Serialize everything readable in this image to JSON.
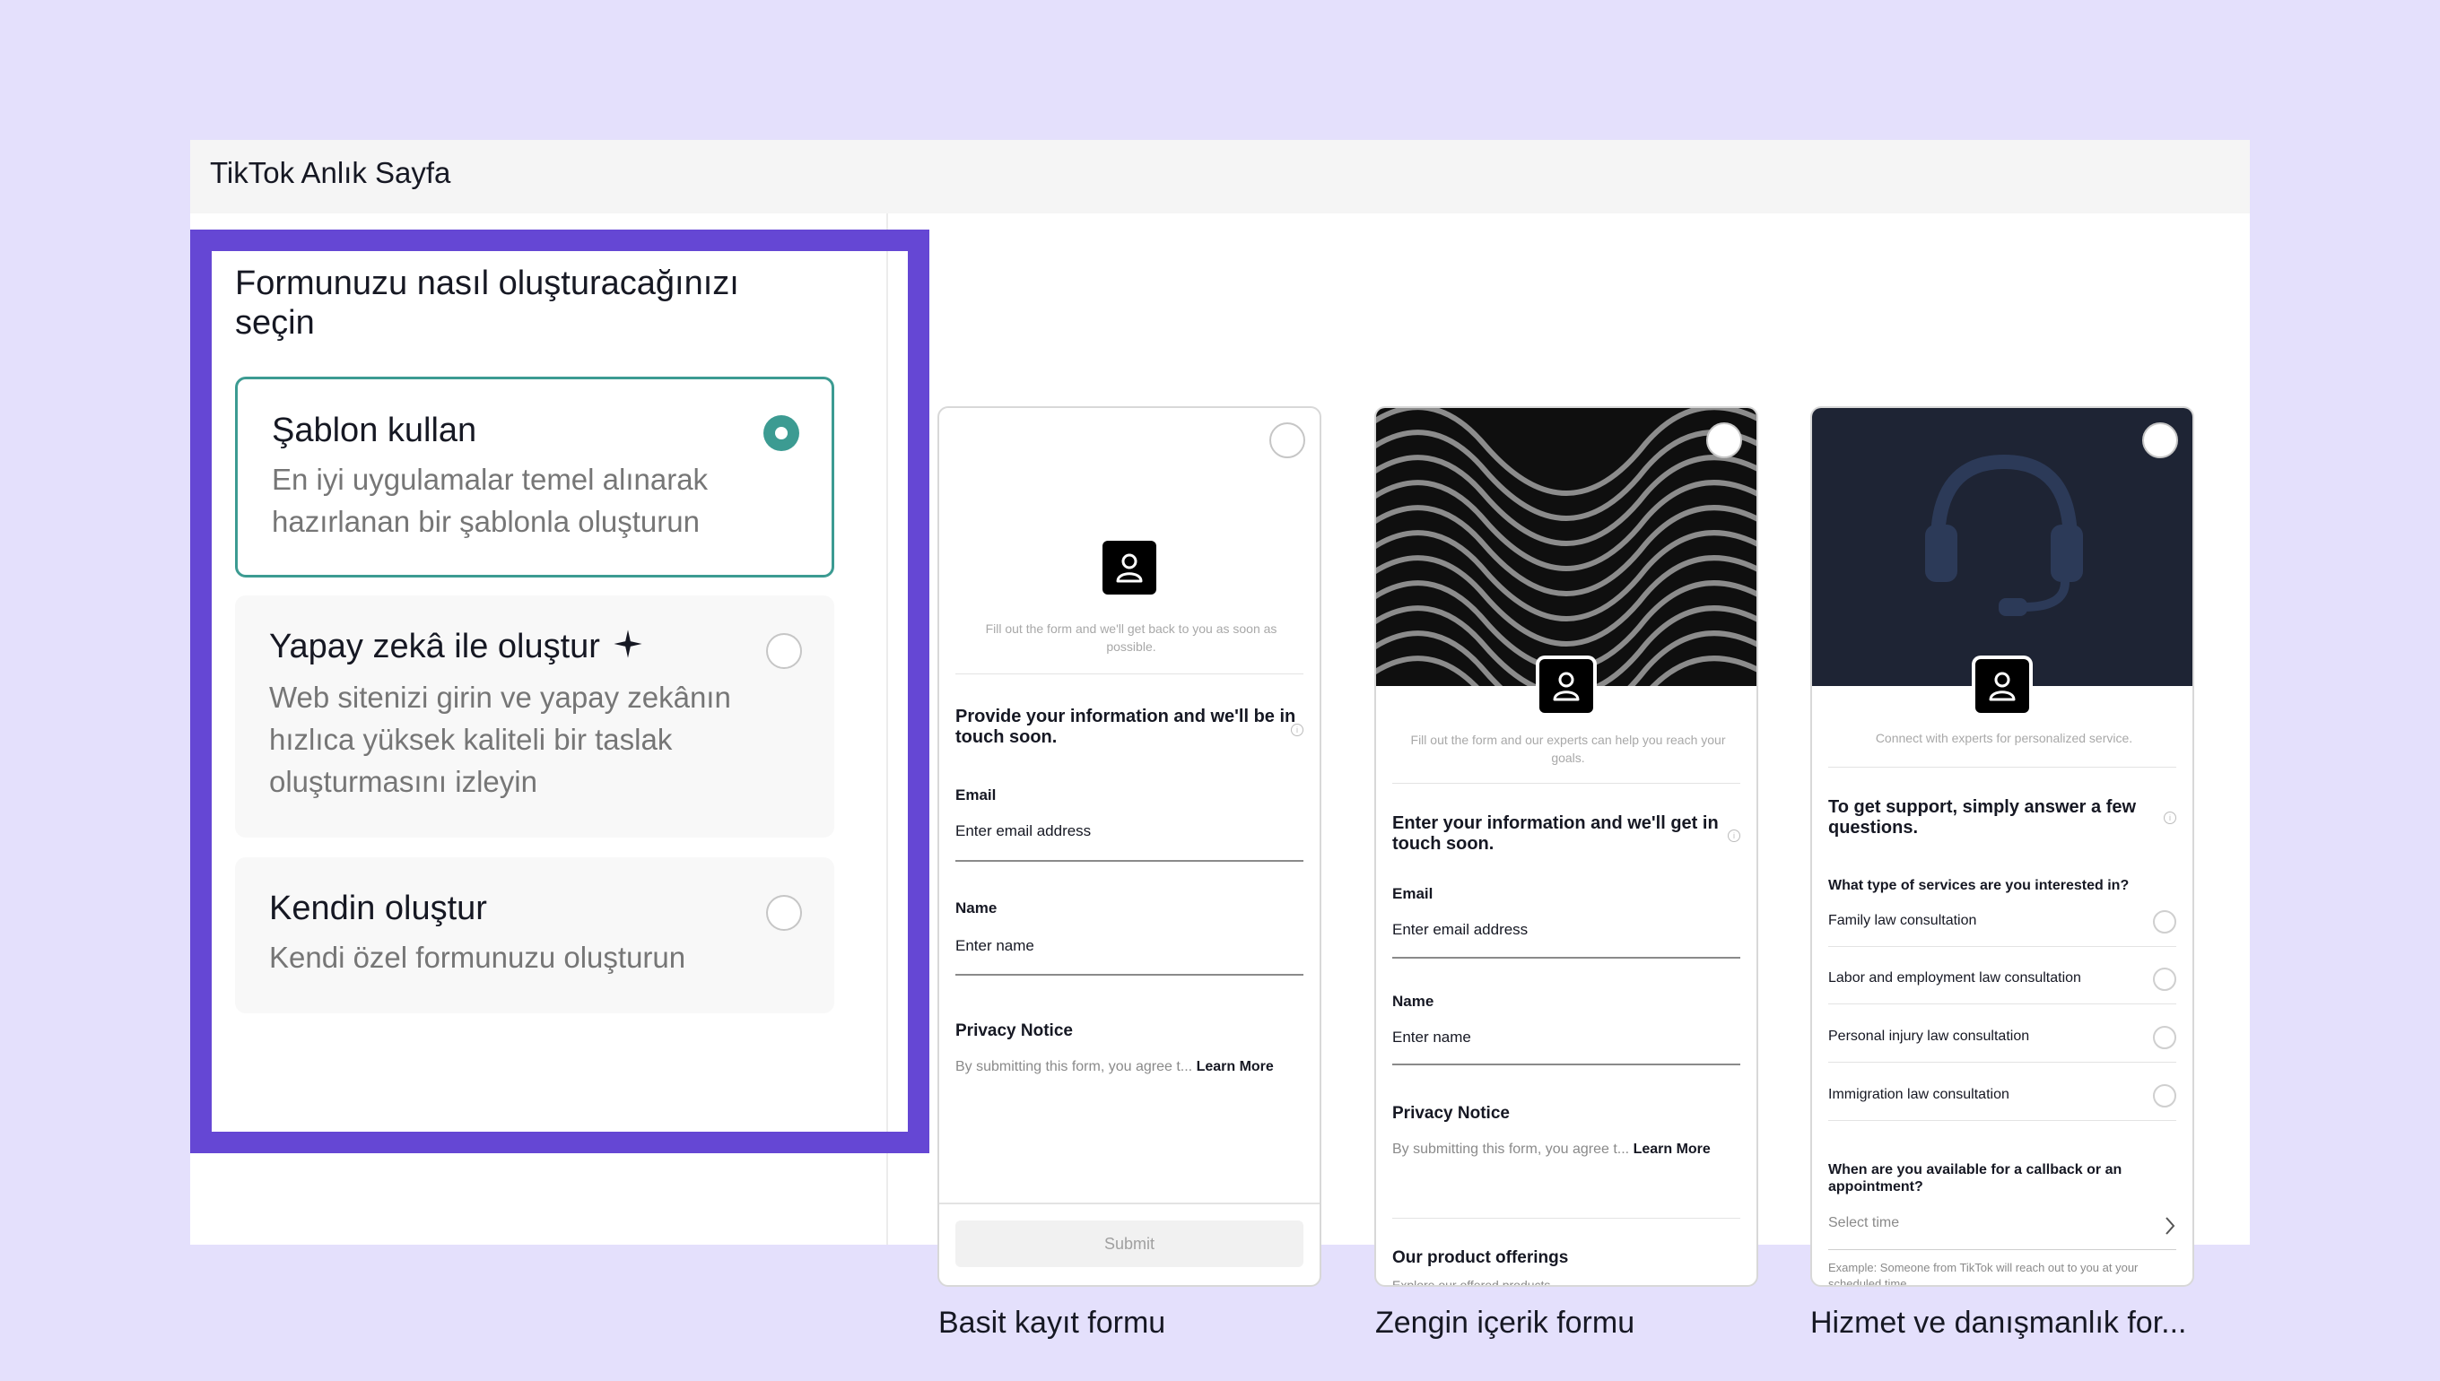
{
  "window": {
    "title": "TikTok Anlık Sayfa"
  },
  "left_panel": {
    "title": "Formunuzu nasıl oluşturacağınızı seçin",
    "options": [
      {
        "title": "Şablon kullan",
        "description": "En iyi uygulamalar temel alınarak hazırlanan bir şablonla oluşturun",
        "selected": true
      },
      {
        "title": "Yapay zekâ ile oluştur",
        "description": "Web sitenizi girin ve yapay zekânın hızlıca yüksek kaliteli bir taslak oluşturmasını izleyin",
        "selected": false,
        "icon": "sparkle-icon"
      },
      {
        "title": "Kendin oluştur",
        "description": "Kendi özel formunuzu oluşturun",
        "selected": false
      }
    ]
  },
  "templates": [
    {
      "caption": "Basit kayıt formu",
      "subtitle": "Fill out the form and we'll get back to you as soon as possible.",
      "heading": "Provide your information and we'll be in touch soon.",
      "email_label": "Email",
      "email_placeholder": "Enter email address",
      "name_label": "Name",
      "name_placeholder": "Enter name",
      "privacy_title": "Privacy Notice",
      "privacy_text": "By submitting this form, you agree t...",
      "learn_more": "Learn More",
      "submit": "Submit"
    },
    {
      "caption": "Zengin içerik formu",
      "subtitle": "Fill out the form and our experts can help you reach your goals.",
      "heading": "Enter your information and we'll get in touch soon.",
      "email_label": "Email",
      "email_placeholder": "Enter email address",
      "name_label": "Name",
      "name_placeholder": "Enter name",
      "privacy_title": "Privacy Notice",
      "privacy_text": "By submitting this form, you agree t...",
      "learn_more": "Learn More",
      "offerings": "Our product offerings",
      "offerings_sub": "Explore our offered products"
    },
    {
      "caption": "Hizmet ve danışmanlık for...",
      "subtitle": "Connect with experts for personalized service.",
      "heading": "To get support, simply answer a few questions.",
      "question1": "What type of services are you interested in?",
      "choices": [
        "Family law consultation",
        "Labor and employment law consultation",
        "Personal injury law consultation",
        "Immigration law consultation"
      ],
      "question2": "When are you available for a callback or an appointment?",
      "select_placeholder": "Select time",
      "example": "Example: Someone from TikTok will reach out to you at your scheduled time."
    }
  ],
  "colors": {
    "accent": "#3c9b92",
    "highlight": "#6547d4",
    "background": "#e4e0fc"
  }
}
